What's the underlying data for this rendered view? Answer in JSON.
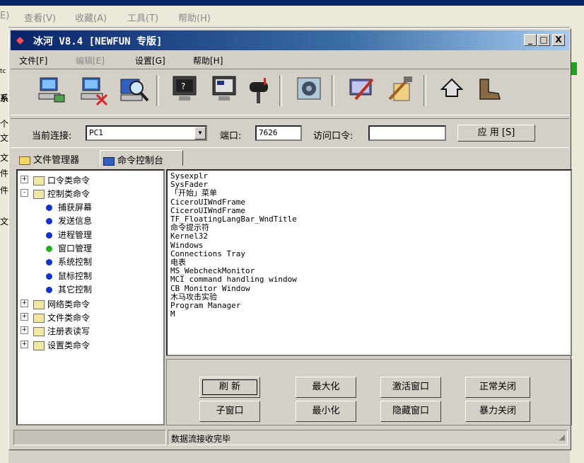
{
  "host_menu": [
    "E)",
    "查看(V)",
    "收藏(A)",
    "工具(T)",
    "帮助(H)"
  ],
  "host_left_fragments": [
    "tc",
    "系",
    "个",
    "文",
    "文",
    "件",
    "件",
    "文"
  ],
  "app": {
    "title": "冰河 V8.4 [NEWFUN 专版]",
    "window_buttons": {
      "minimize": "_",
      "maximize": "□",
      "close": "X"
    },
    "menu": {
      "file": "文件[F]",
      "edit": "编辑[E]",
      "settings": "设置[G]",
      "help": "帮助[H]"
    },
    "toolbar_icons": [
      "connect-computer-icon",
      "disconnect-computer-icon",
      "search-computer-icon",
      "monitor-icon",
      "screen-control-icon",
      "mailbox-icon",
      "network-card-icon",
      "config-server-icon",
      "tools-icon",
      "back-arrow-icon",
      "exit-boot-icon"
    ],
    "connection": {
      "current_label": "当前连接:",
      "current_value": "PC1",
      "port_label": "端口:",
      "port_value": "7626",
      "password_label": "访问口令:",
      "password_value": "",
      "apply_label": "应 用 [S]"
    },
    "tabs": {
      "file_manager": "文件管理器",
      "command_console": "命令控制台"
    },
    "tree": [
      {
        "label": "口令类命令",
        "expander": "+",
        "level": 0
      },
      {
        "label": "控制类命令",
        "expander": "-",
        "level": 0
      },
      {
        "label": "捕获屏幕",
        "level": 1
      },
      {
        "label": "发送信息",
        "level": 1
      },
      {
        "label": "进程管理",
        "level": 1
      },
      {
        "label": "窗口管理",
        "level": 1,
        "selected": true
      },
      {
        "label": "系统控制",
        "level": 1
      },
      {
        "label": "鼠标控制",
        "level": 1
      },
      {
        "label": "其它控制",
        "level": 1
      },
      {
        "label": "网络类命令",
        "expander": "+",
        "level": 0
      },
      {
        "label": "文件类命令",
        "expander": "+",
        "level": 0
      },
      {
        "label": "注册表读写",
        "expander": "+",
        "level": 0
      },
      {
        "label": "设置类命令",
        "expander": "+",
        "level": 0
      }
    ],
    "window_list": [
      "Sysexplr",
      "SysFader",
      "「开始」菜单",
      "CiceroUIWndFrame",
      "CiceroUIWndFrame",
      "TF_FloatingLangBar_WndTitle",
      "命令提示符",
      "Kernel32",
      "Windows",
      "Connections Tray",
      "电表",
      "MS_WebcheckMonitor",
      "MCI command handling window",
      "CB Monitor Window",
      "木马攻击实验",
      "Program Manager",
      "M"
    ],
    "buttons": {
      "refresh": "刷 新",
      "maximize": "最大化",
      "activate": "激活窗口",
      "close_normal": "正常关闭",
      "child": "子窗口",
      "minimize": "最小化",
      "hide": "隐藏窗口",
      "close_force": "暴力关闭"
    },
    "status_text": "数据流接收完毕"
  },
  "colors": {
    "title_start": "#0a246a",
    "title_end": "#a6caf0",
    "face": "#d4d0c8",
    "dot_blue": "#1030d0",
    "dot_green": "#20b020"
  }
}
